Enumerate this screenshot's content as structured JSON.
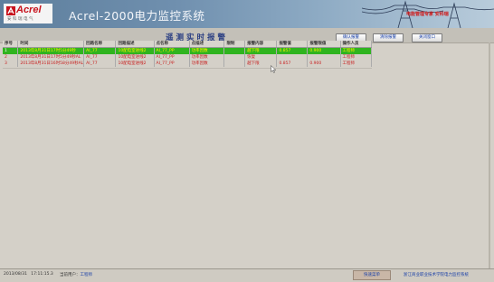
{
  "header": {
    "logo_text": "Acrel",
    "logo_subtitle": "安科瑞电气",
    "app_title": "Acrel-2000电力监控系统",
    "tagline": "电能管理专家 安科瑞"
  },
  "toolbar": {
    "page_title": "遥测实时报警",
    "confirm_label": "确认报警",
    "clear_label": "清除报警",
    "close_label": "关闭窗口"
  },
  "table": {
    "columns": [
      "序号",
      "时间",
      "回路名称",
      "回路描述",
      "点名称",
      "点描述",
      "限制",
      "报警内容",
      "报警值",
      "报警限值",
      "操作人员"
    ],
    "rows": [
      {
        "idx": "1",
        "time": "2013年8月31日17时5分49秒",
        "loop": "AI_77",
        "desc": "10配电室进线2",
        "point": "AI_77_PP",
        "pdesc": "功率因数",
        "limit": "",
        "content": "越下限",
        "value": "0.857",
        "limitval": "0.900",
        "operator": "工程师"
      },
      {
        "idx": "2",
        "time": "2013年8月31日17时5分49秒AL",
        "loop": "AI_77",
        "desc": "10配电室进线2",
        "point": "AI_77_PP",
        "pdesc": "功率因数",
        "limit": "",
        "content": "恢复",
        "value": "",
        "limitval": "",
        "operator": "工程师"
      },
      {
        "idx": "3",
        "time": "2013年8月31日16时58分49秒AL",
        "loop": "AI_77",
        "desc": "10配电室进线2",
        "point": "AI_77_PP",
        "pdesc": "功率因数",
        "limit": "",
        "content": "越下限",
        "value": "0.857",
        "limitval": "0.900",
        "operator": "工程师"
      }
    ]
  },
  "status": {
    "date": "2013/08/31",
    "time": "17:11:15.3",
    "user_prefix": "当前用户：",
    "user": "工程师",
    "quick_menu": "快速菜单",
    "org": "浙江商业职业技术学院电力监控系统"
  },
  "colors": {
    "selected_row": "#2fb41f",
    "alarm_text": "#c81e1e",
    "accent_blue": "#1a40a8"
  }
}
